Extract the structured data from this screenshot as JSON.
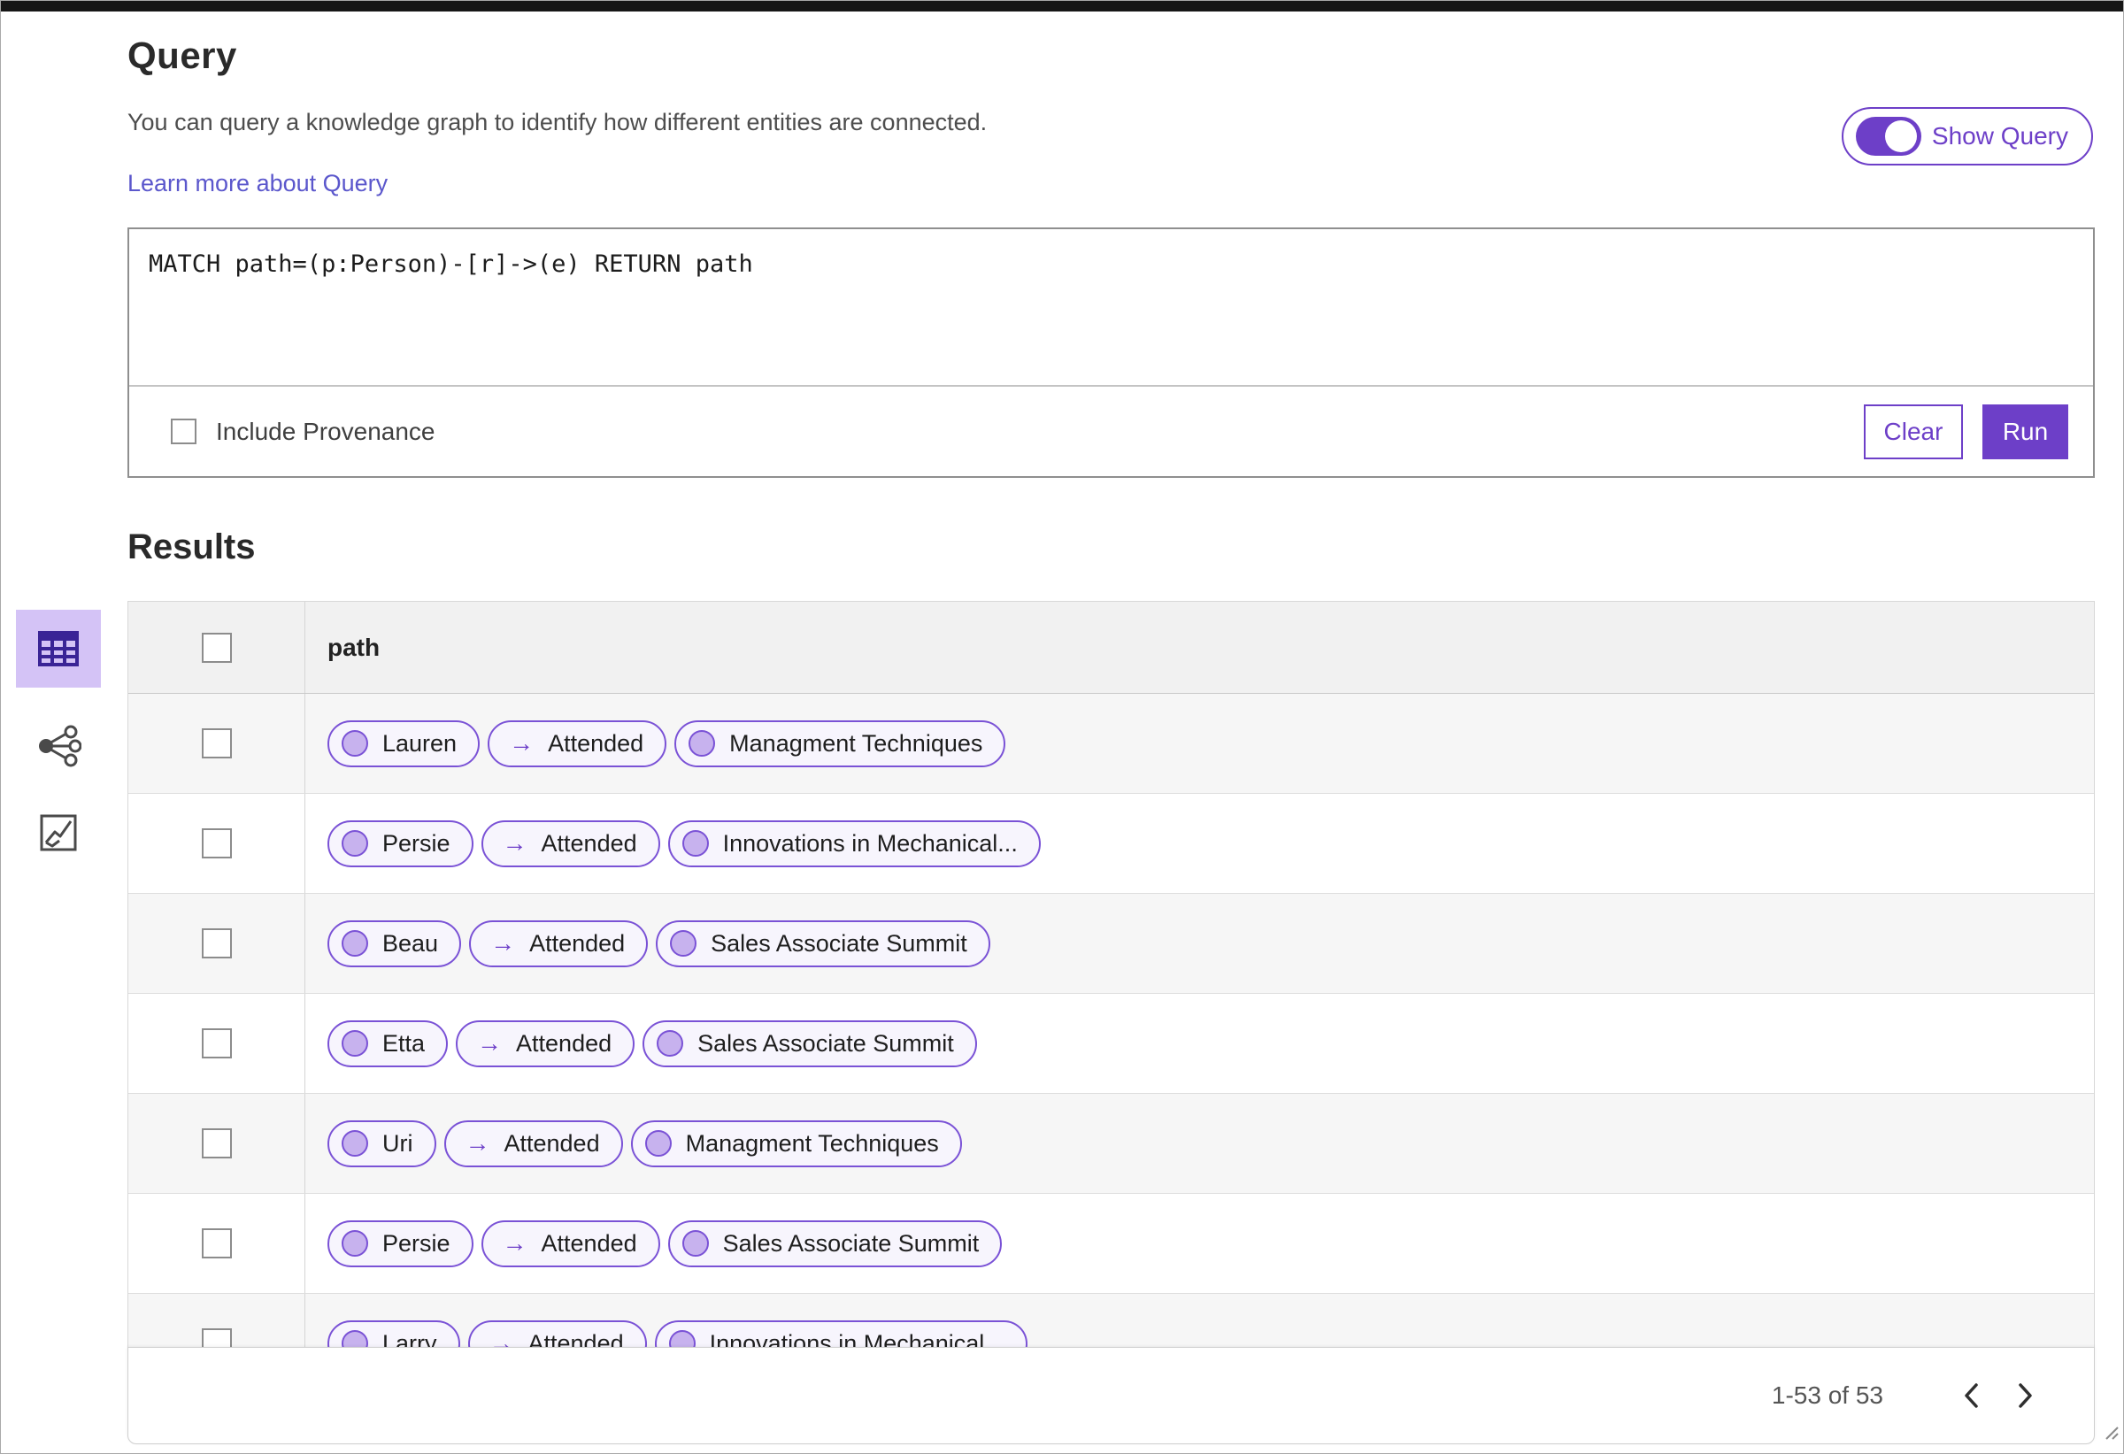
{
  "header": {
    "title": "Query",
    "description": "You can query a knowledge graph to identify how different entities are connected.",
    "learn_more_link": "Learn more about Query",
    "show_query_toggle": {
      "label": "Show Query",
      "state": "on"
    }
  },
  "query_editor": {
    "query_text": "MATCH path=(p:Person)-[r]->(e) RETURN path",
    "include_provenance": {
      "label": "Include Provenance",
      "checked": false
    },
    "buttons": {
      "clear": "Clear",
      "run": "Run"
    }
  },
  "results": {
    "heading": "Results",
    "view_switcher": [
      {
        "name": "table-view",
        "icon": "table-icon",
        "selected": true
      },
      {
        "name": "graph-view",
        "icon": "graph-icon",
        "selected": false
      },
      {
        "name": "chart-view",
        "icon": "chart-icon",
        "selected": false
      }
    ],
    "table": {
      "column_header": "path",
      "relation_arrow": "→",
      "rows": [
        {
          "entity": "Lauren",
          "relation": "Attended",
          "target": "Managment Techniques"
        },
        {
          "entity": "Persie",
          "relation": "Attended",
          "target": "Innovations in Mechanical..."
        },
        {
          "entity": "Beau",
          "relation": "Attended",
          "target": "Sales Associate Summit"
        },
        {
          "entity": "Etta",
          "relation": "Attended",
          "target": "Sales Associate Summit"
        },
        {
          "entity": "Uri",
          "relation": "Attended",
          "target": "Managment Techniques"
        },
        {
          "entity": "Persie",
          "relation": "Attended",
          "target": "Sales Associate Summit"
        },
        {
          "entity": "Larry",
          "relation": "Attended",
          "target": "Innovations in Mechanical..."
        }
      ]
    },
    "pagination": {
      "range_label": "1-53 of 53"
    }
  },
  "colors": {
    "accent_purple": "#6d3fc8",
    "pill_border": "#7a52d6",
    "pill_background": "#f7f5fd",
    "node_fill": "#c7b2ee",
    "selected_tile_background": "#d4c3f6",
    "table_icon_purple": "#3a2496",
    "header_row_background": "#f1f1f1",
    "alt_row_background": "#f6f6f6",
    "link_color": "#5b57cc"
  }
}
